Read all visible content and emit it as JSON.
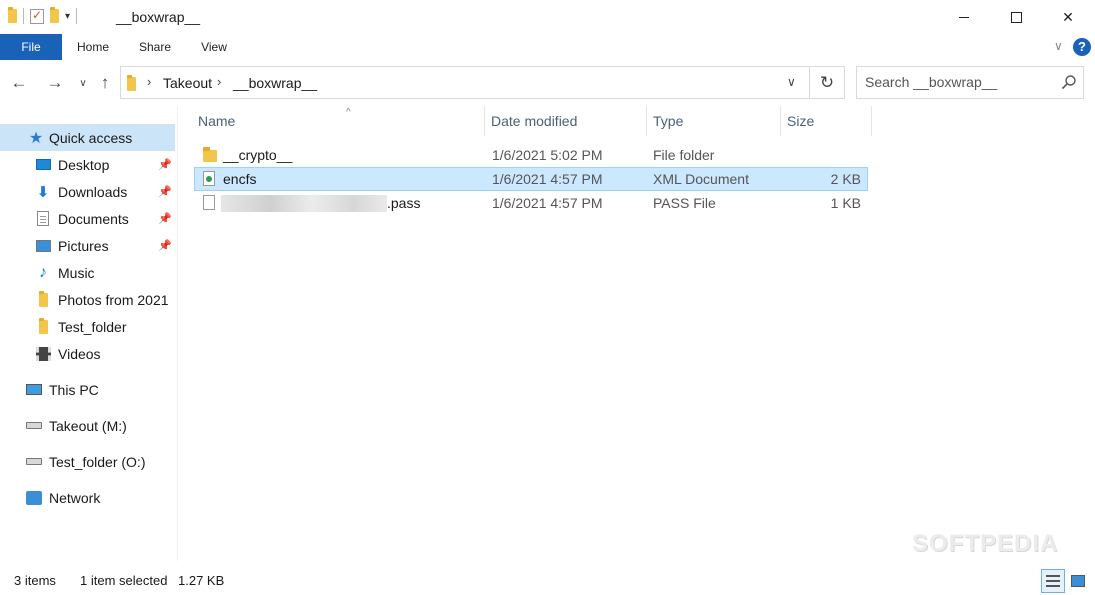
{
  "window": {
    "title": "__boxwrap__"
  },
  "ribbon": {
    "tabs": [
      {
        "label": "File"
      },
      {
        "label": "Home"
      },
      {
        "label": "Share"
      },
      {
        "label": "View"
      }
    ],
    "help": "?"
  },
  "address": {
    "crumbs": [
      "Takeout",
      "__boxwrap__"
    ],
    "search_placeholder": "Search __boxwrap__"
  },
  "navpane": {
    "quick_access": "Quick access",
    "quick_items": [
      {
        "label": "Desktop",
        "icon": "desktop-icon",
        "pinned": true
      },
      {
        "label": "Downloads",
        "icon": "downloads-icon",
        "pinned": true
      },
      {
        "label": "Documents",
        "icon": "documents-icon",
        "pinned": true
      },
      {
        "label": "Pictures",
        "icon": "pictures-icon",
        "pinned": true
      },
      {
        "label": "Music",
        "icon": "music-icon",
        "pinned": false
      },
      {
        "label": "Photos from 2021",
        "icon": "folder-icon",
        "pinned": false
      },
      {
        "label": "Test_folder",
        "icon": "folder-icon",
        "pinned": false
      },
      {
        "label": "Videos",
        "icon": "videos-icon",
        "pinned": false
      }
    ],
    "this_pc": "This PC",
    "drives": [
      {
        "label": "Takeout (M:)"
      },
      {
        "label": "Test_folder (O:)"
      }
    ],
    "network": "Network"
  },
  "columns": {
    "name": "Name",
    "date": "Date modified",
    "type": "Type",
    "size": "Size"
  },
  "files": [
    {
      "name": "__crypto__",
      "date": "1/6/2021 5:02 PM",
      "type": "File folder",
      "size": "",
      "icon": "folder-icon",
      "selected": false
    },
    {
      "name": "encfs",
      "date": "1/6/2021 4:57 PM",
      "type": "XML Document",
      "size": "2 KB",
      "icon": "xml-file-icon",
      "selected": true
    },
    {
      "name": ".pass",
      "date": "1/6/2021 4:57 PM",
      "type": "PASS File",
      "size": "1 KB",
      "icon": "file-icon",
      "selected": false
    }
  ],
  "status": {
    "item_count": "3 items",
    "selection": "1 item selected",
    "selection_size": "1.27 KB"
  },
  "watermark": "SOFTPEDIA",
  "colors": {
    "accent": "#1a62b8",
    "selection": "#cce8ff",
    "nav_selection": "#cce4f7"
  }
}
